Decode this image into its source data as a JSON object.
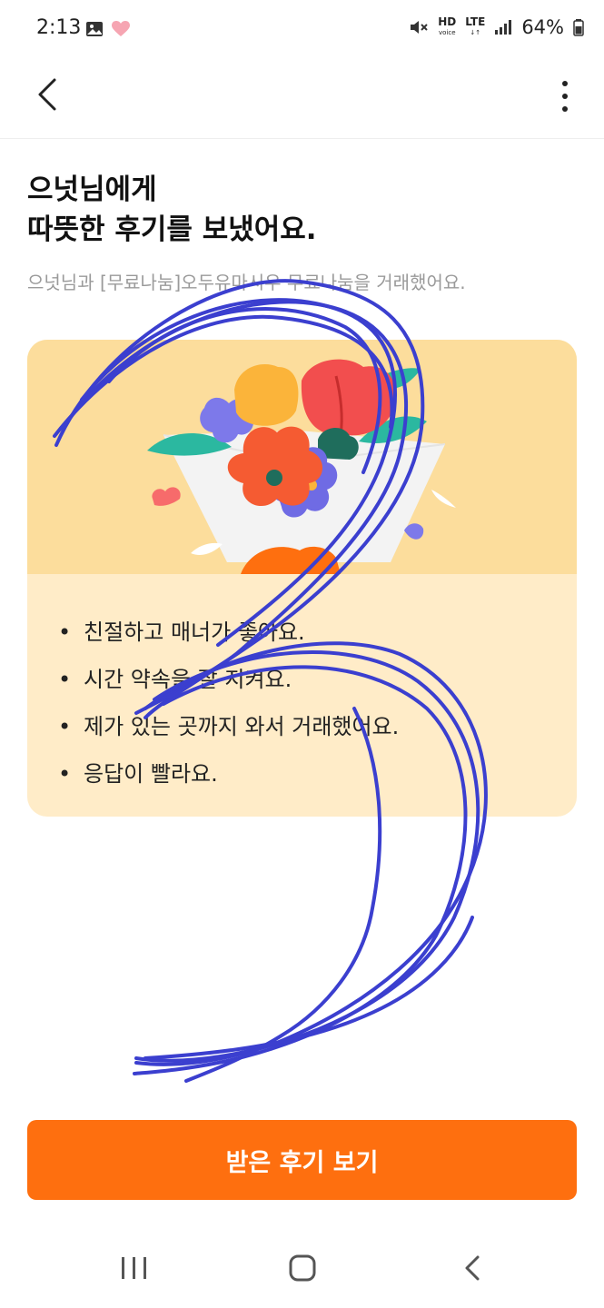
{
  "status_bar": {
    "time": "2:13",
    "battery": "64%",
    "network_label": "LTE",
    "hd_label": "HD",
    "hd_sub": "voice"
  },
  "header": {
    "title_line1": "으넛님에게",
    "title_line2": "따뜻한 후기를 보냈어요.",
    "subtitle": "으넛님과 [무료나눔]오두유마시우 무료나눔을 거래했어요."
  },
  "review_card": {
    "items": [
      "친절하고 매너가 좋아요.",
      "시간 약속을 잘 지켜요.",
      "제가 있는 곳까지 와서 거래했어요.",
      "응답이 빨라요."
    ]
  },
  "cta": {
    "label": "받은 후기 보기"
  },
  "colors": {
    "accent": "#fe6f0f",
    "card_top": "#fcdd9c",
    "card_bottom": "#ffecc8",
    "scribble": "#3b3fcf"
  }
}
